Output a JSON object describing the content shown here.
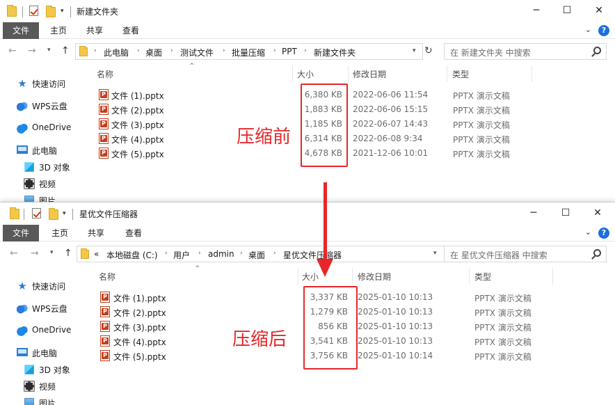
{
  "window1": {
    "title": "新建文件夹",
    "ribbon_tabs": [
      "文件",
      "主页",
      "共享",
      "查看"
    ],
    "breadcrumbs": [
      "此电脑",
      "桌面",
      "测试文件",
      "批量压缩",
      "PPT",
      "新建文件夹"
    ],
    "search_placeholder": "在 新建文件夹 中搜索",
    "sidebar": [
      "快速访问",
      "WPS云盘",
      "OneDrive",
      "此电脑",
      "3D 对象",
      "视频",
      "图片"
    ],
    "columns": {
      "name": "名称",
      "size": "大小",
      "date": "修改日期",
      "type": "类型"
    },
    "files": [
      {
        "name": "文件 (1).pptx",
        "size": "6,380 KB",
        "date": "2022-06-06 11:54",
        "type": "PPTX 演示文稿"
      },
      {
        "name": "文件 (2).pptx",
        "size": "1,883 KB",
        "date": "2022-06-06 15:15",
        "type": "PPTX 演示文稿"
      },
      {
        "name": "文件 (3).pptx",
        "size": "1,185 KB",
        "date": "2022-06-07 14:43",
        "type": "PPTX 演示文稿"
      },
      {
        "name": "文件 (4).pptx",
        "size": "6,314 KB",
        "date": "2022-06-08 9:34",
        "type": "PPTX 演示文稿"
      },
      {
        "name": "文件 (5).pptx",
        "size": "4,678 KB",
        "date": "2021-12-06 10:01",
        "type": "PPTX 演示文稿"
      }
    ],
    "annotation": "压缩前"
  },
  "window2": {
    "title": "星优文件压缩器",
    "ribbon_tabs": [
      "文件",
      "主页",
      "共享",
      "查看"
    ],
    "breadcrumb_prefix": "«",
    "breadcrumbs": [
      "本地磁盘 (C:)",
      "用户",
      "admin",
      "桌面",
      "星优文件压缩器"
    ],
    "search_placeholder": "在 星优文件压缩器 中搜索",
    "sidebar": [
      "快速访问",
      "WPS云盘",
      "OneDrive",
      "此电脑",
      "3D 对象",
      "视频",
      "图片"
    ],
    "columns": {
      "name": "名称",
      "size": "大小",
      "date": "修改日期",
      "type": "类型"
    },
    "files": [
      {
        "name": "文件 (1).pptx",
        "size": "3,337 KB",
        "date": "2025-01-10 10:13",
        "type": "PPTX 演示文稿"
      },
      {
        "name": "文件 (2).pptx",
        "size": "1,279 KB",
        "date": "2025-01-10 10:13",
        "type": "PPTX 演示文稿"
      },
      {
        "name": "文件 (3).pptx",
        "size": "856 KB",
        "date": "2025-01-10 10:13",
        "type": "PPTX 演示文稿"
      },
      {
        "name": "文件 (4).pptx",
        "size": "3,541 KB",
        "date": "2025-01-10 10:13",
        "type": "PPTX 演示文稿"
      },
      {
        "name": "文件 (5).pptx",
        "size": "3,756 KB",
        "date": "2025-01-10 10:14",
        "type": "PPTX 演示文稿"
      }
    ],
    "annotation": "压缩后"
  },
  "window_controls": {
    "minimize": "─",
    "maximize": "☐",
    "close": "✕"
  },
  "colors": {
    "annotation_red": "#e8262a",
    "file_tab": "#595959"
  }
}
